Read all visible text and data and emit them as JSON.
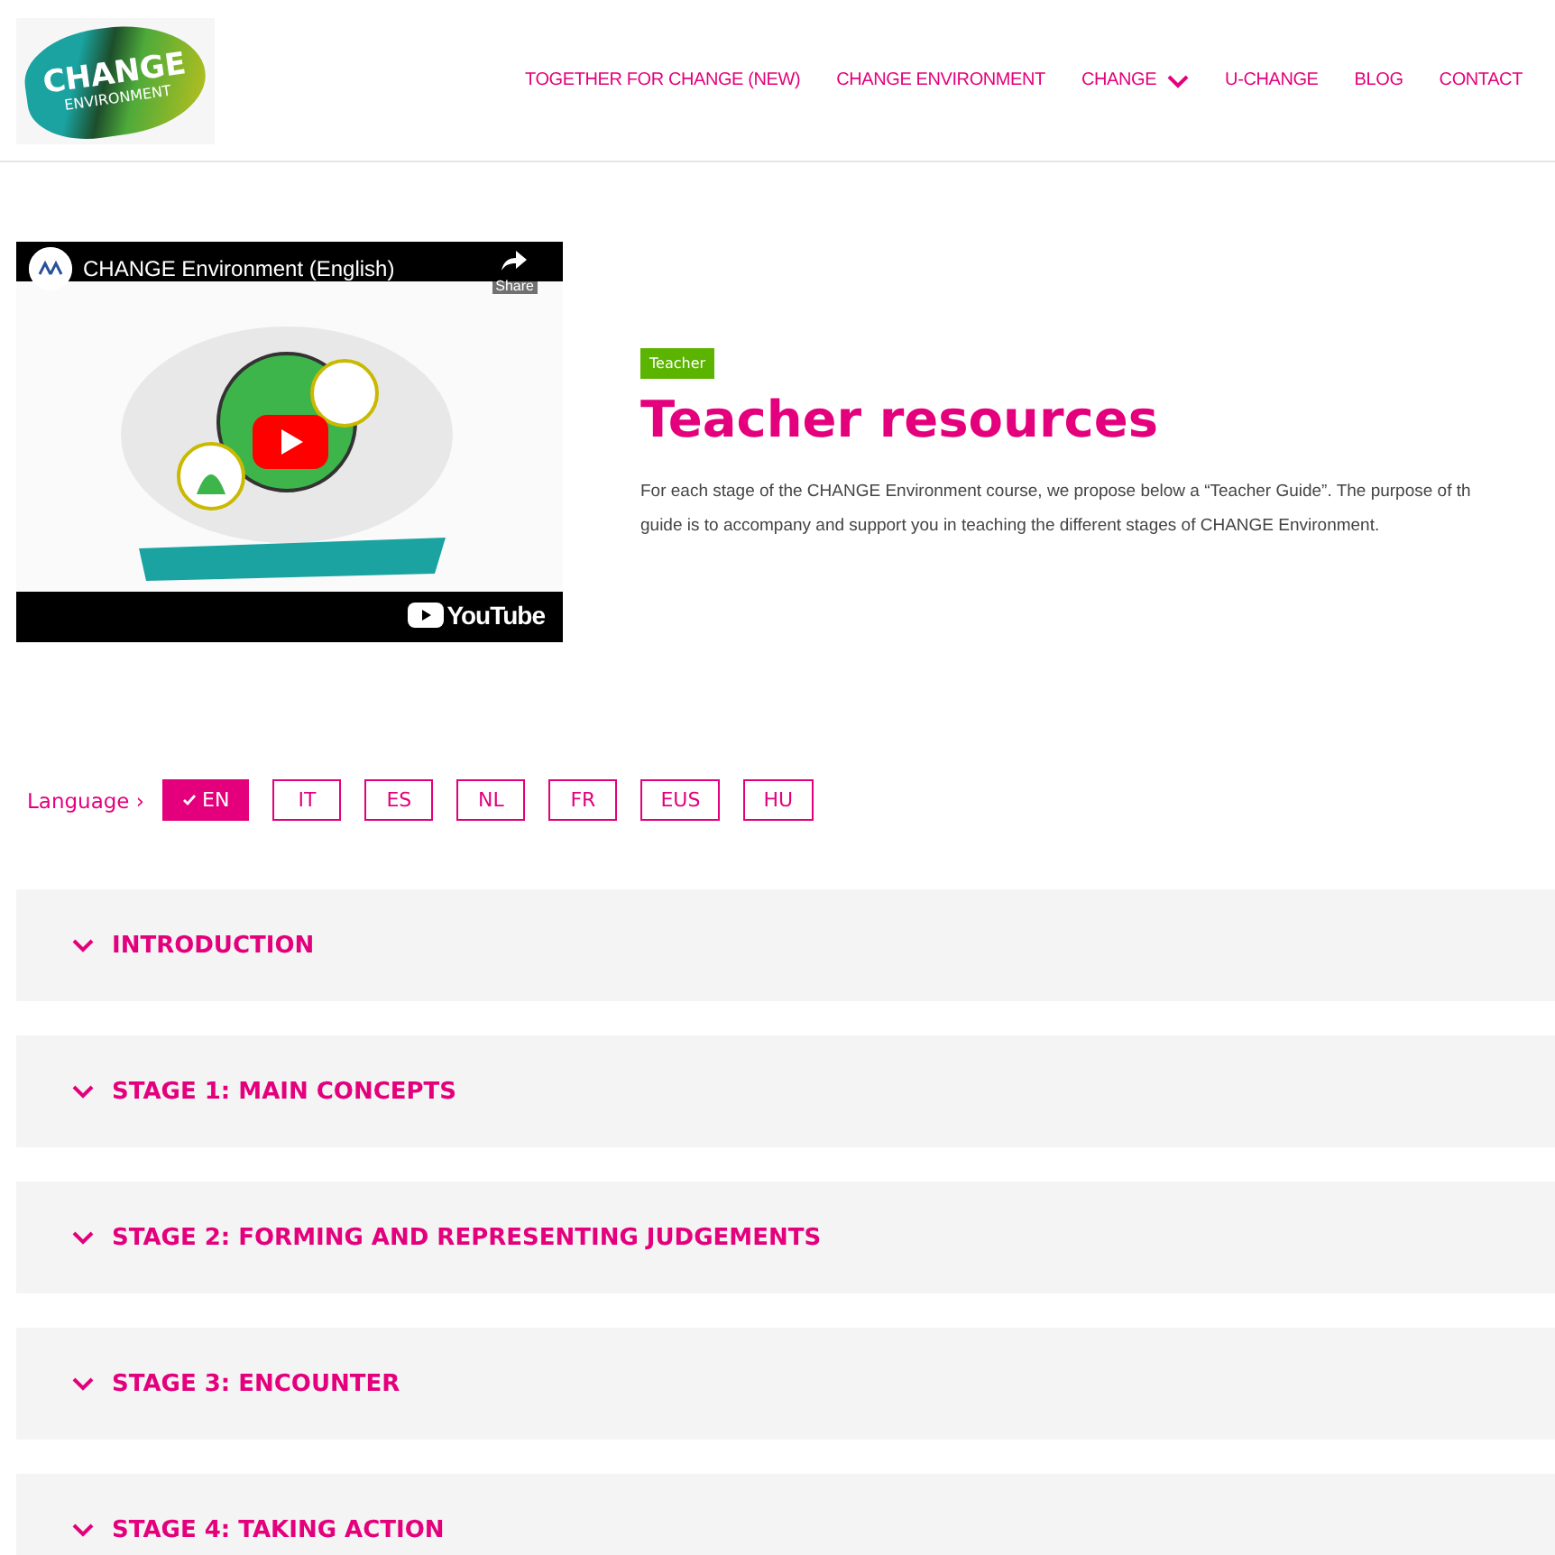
{
  "header": {
    "logo": {
      "line_1": "CHANGE",
      "line_2": "ENVIRONMENT"
    },
    "nav": [
      {
        "label": "TOGETHER FOR CHANGE (NEW)",
        "dropdown": false
      },
      {
        "label": "CHANGE ENVIRONMENT",
        "dropdown": false
      },
      {
        "label": "CHANGE",
        "dropdown": true
      },
      {
        "label": "U-CHANGE",
        "dropdown": false
      },
      {
        "label": "BLOG",
        "dropdown": false
      },
      {
        "label": "CONTACT",
        "dropdown": false
      }
    ]
  },
  "video": {
    "title": "CHANGE Environment (English)",
    "share_label": "Share",
    "brand": "YouTube"
  },
  "intro": {
    "tag": "Teacher",
    "title": "Teacher resources",
    "lines": [
      "For each stage of the CHANGE Environment course, we propose below a “Teacher Guide”. The purpose of th",
      "guide is to accompany and support you in teaching the different stages of CHANGE Environment."
    ]
  },
  "languages": {
    "label": "Language ›",
    "items": [
      {
        "label": "EN",
        "selected": true
      },
      {
        "label": "IT",
        "selected": false
      },
      {
        "label": "ES",
        "selected": false
      },
      {
        "label": "NL",
        "selected": false
      },
      {
        "label": "FR",
        "selected": false
      },
      {
        "label": "EUS",
        "selected": false
      },
      {
        "label": "HU",
        "selected": false
      }
    ]
  },
  "sections": [
    {
      "title": "INTRODUCTION"
    },
    {
      "title": "STAGE 1: MAIN CONCEPTS"
    },
    {
      "title": "STAGE 2: FORMING AND REPRESENTING JUDGEMENTS"
    },
    {
      "title": "STAGE 3: ENCOUNTER"
    },
    {
      "title": "STAGE 4: TAKING ACTION"
    }
  ]
}
